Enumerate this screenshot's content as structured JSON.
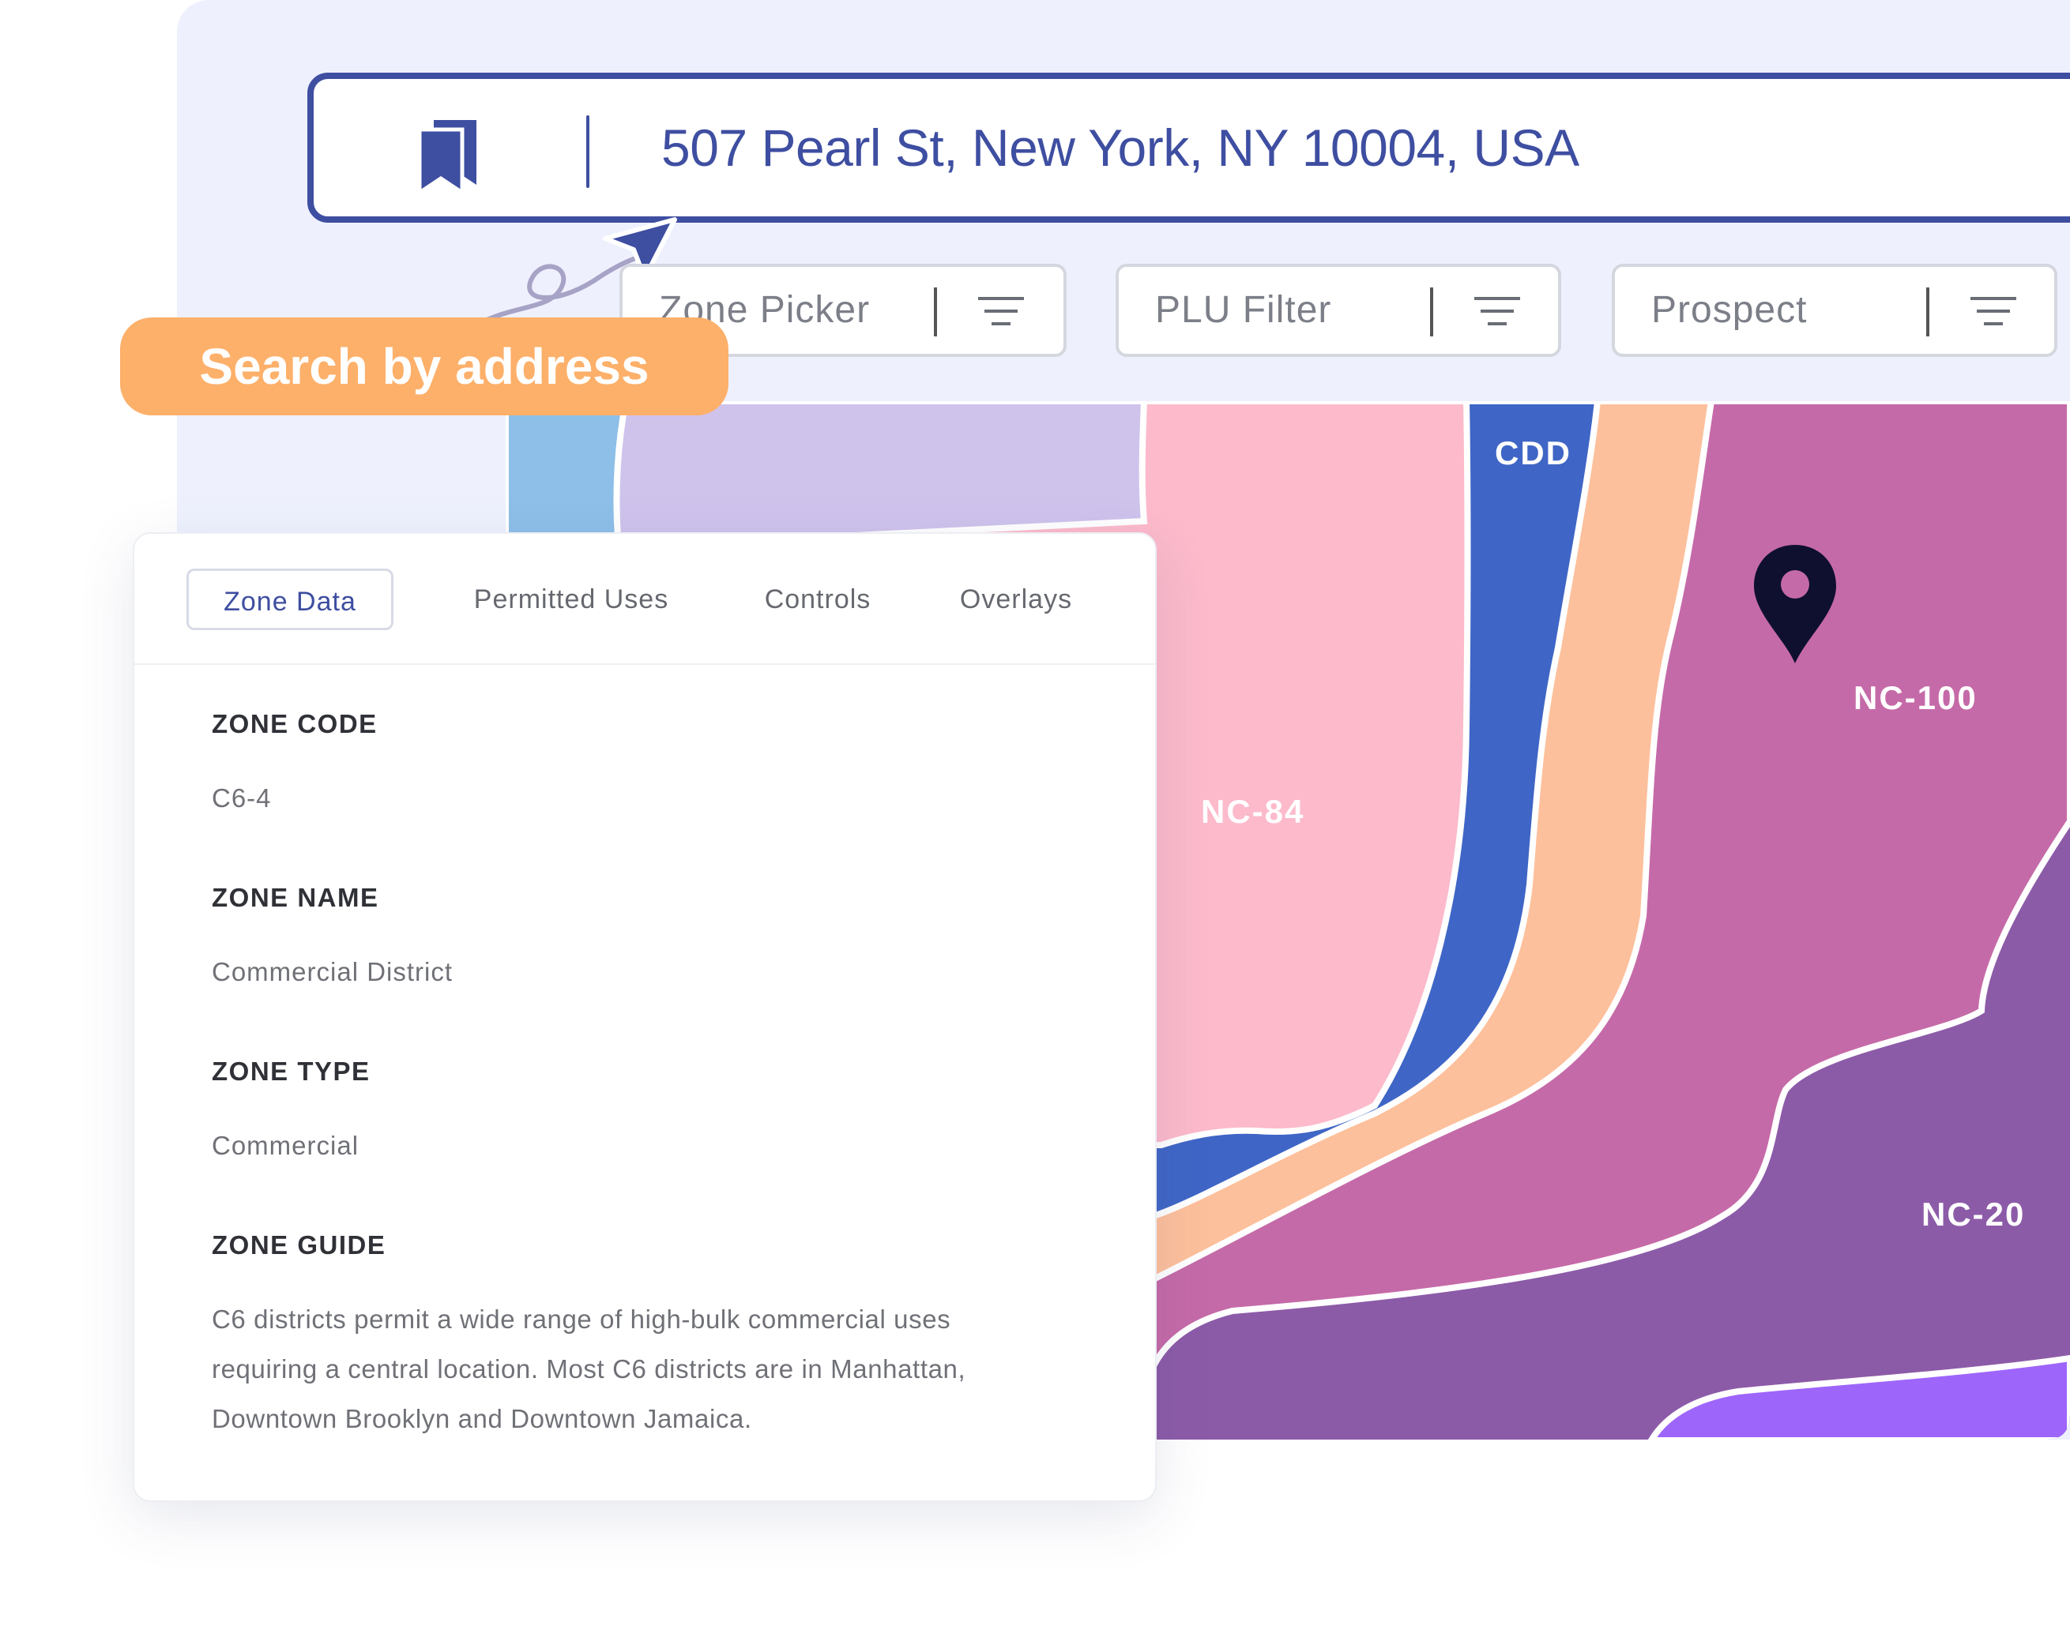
{
  "search": {
    "address": "507 Pearl St, New York, NY 10004, USA"
  },
  "filters": [
    {
      "label": "Zone Picker"
    },
    {
      "label": "PLU Filter"
    },
    {
      "label": "Prospect"
    }
  ],
  "callout": {
    "label": "Search by address",
    "color": "#fdb06a"
  },
  "map": {
    "zones": [
      {
        "label": "CDD",
        "color": "#3f66c6"
      },
      {
        "label": "NC-84",
        "color": "#fcbacb"
      },
      {
        "label": "NC-100",
        "color": "#c56aa8"
      },
      {
        "label": "NC-20",
        "color": "#8f5ca8"
      }
    ],
    "pin_icon": "map-pin-icon"
  },
  "card": {
    "tabs": [
      {
        "label": "Zone Data",
        "active": true
      },
      {
        "label": "Permitted Uses",
        "active": false
      },
      {
        "label": "Controls",
        "active": false
      },
      {
        "label": "Overlays",
        "active": false
      }
    ],
    "fields": {
      "zone_code": {
        "label": "ZONE CODE",
        "value": "C6-4"
      },
      "zone_name": {
        "label": "ZONE NAME",
        "value": "Commercial District"
      },
      "zone_type": {
        "label": "ZONE TYPE",
        "value": "Commercial"
      },
      "zone_guide": {
        "label": "ZONE GUIDE",
        "lines": [
          "C6 districts permit a wide range of high-bulk commercial uses",
          "requiring a central location. Most C6 districts are in Manhattan,",
          "Downtown Brooklyn and Downtown Jamaica."
        ]
      }
    }
  },
  "colors": {
    "brand": "#3e4ea1",
    "background": "#eef1fd"
  }
}
